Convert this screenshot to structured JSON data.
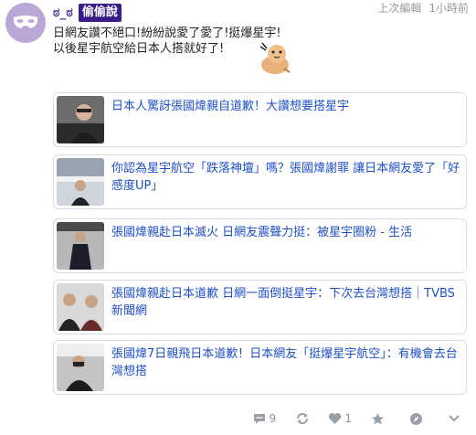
{
  "post": {
    "author": "ಠ_ಠ",
    "badge": "偷偷說",
    "edited": "上次編輯",
    "time": "1小時前",
    "lines": [
      "日網友讚不絕口!紛紛說愛了愛了!挺爆星宇!",
      "以後星宇航空給日本人搭就好了!"
    ]
  },
  "links": [
    {
      "title": "日本人驚訝張國煒親自道歉！大讚想要搭星宇"
    },
    {
      "title": "你認為星宇航空「跌落神壇」嗎？張國煒謝罪 讓日本網友愛了「好感度UP」"
    },
    {
      "title": "張國煒親赴日本滅火 日網友震聲力挺：被星宇圈粉 - 生活"
    },
    {
      "title": "張國煒親赴日本道歉 日網一面倒挺星宇：下次去台灣想搭｜TVBS新聞網"
    },
    {
      "title": "張國煒7日親飛日本道歉！日本網友「挺爆星宇航空」：有機會去台灣想搭"
    }
  ],
  "actions": {
    "comments": "9",
    "likes": "1"
  },
  "colors": {
    "badge_bg": "#3a1d86",
    "link": "#1e4fc6",
    "avatar": "#b9a7d6"
  },
  "icons": [
    "mask-icon",
    "comment-icon",
    "repost-icon",
    "heart-icon",
    "star-icon",
    "compass-icon",
    "chevron-down-icon"
  ]
}
